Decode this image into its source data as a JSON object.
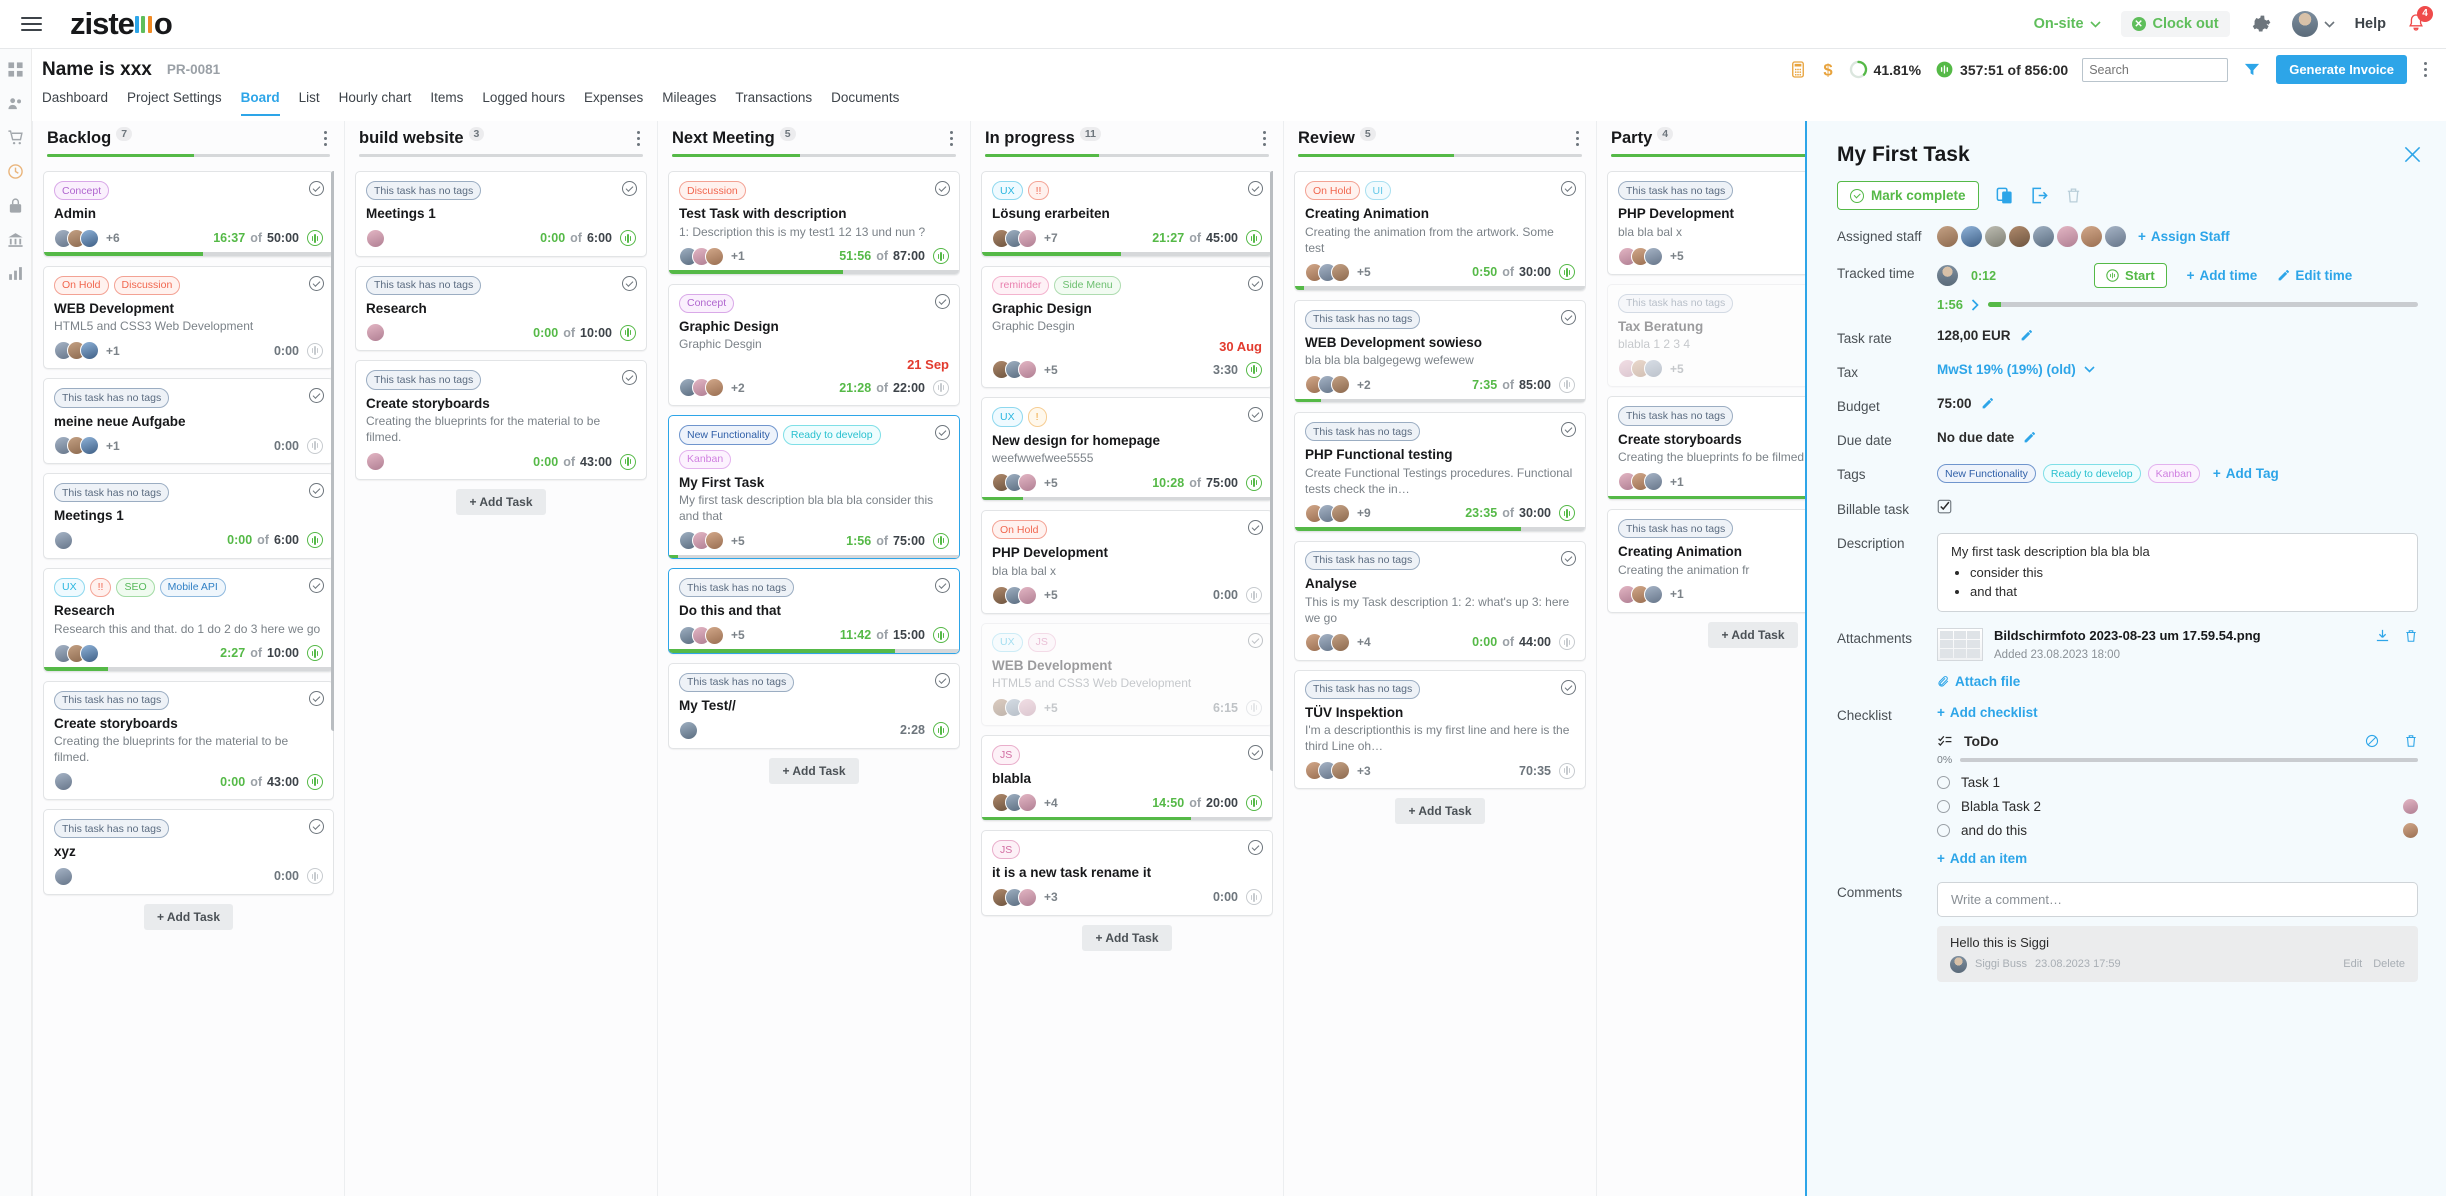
{
  "brand": {
    "name": "zistemo",
    "bar_colors": [
      "#2da5e8",
      "#5fbe5b",
      "#f08a24"
    ]
  },
  "topbar": {
    "onsite_label": "On-site",
    "clockout_label": "Clock out",
    "help_label": "Help",
    "notification_count": "4"
  },
  "project": {
    "name": "Name is xxx",
    "code": "PR-0081",
    "percent": "41.81%",
    "time": "357:51 of 856:00",
    "search_placeholder": "Search",
    "generate_label": "Generate Invoice"
  },
  "tabs": [
    {
      "label": "Dashboard",
      "active": false
    },
    {
      "label": "Project Settings",
      "active": false
    },
    {
      "label": "Board",
      "active": true
    },
    {
      "label": "List",
      "active": false
    },
    {
      "label": "Hourly chart",
      "active": false
    },
    {
      "label": "Items",
      "active": false
    },
    {
      "label": "Logged hours",
      "active": false
    },
    {
      "label": "Expenses",
      "active": false
    },
    {
      "label": "Mileages",
      "active": false
    },
    {
      "label": "Transactions",
      "active": false
    },
    {
      "label": "Documents",
      "active": false
    }
  ],
  "add_task_label": "+ Add Task",
  "columns": [
    {
      "title": "Backlog",
      "count": "7",
      "progress": 52,
      "cards": [
        {
          "tags": [
            {
              "label": "Concept",
              "cls": "t-concept"
            }
          ],
          "title": "Admin",
          "desc": "",
          "avatars": 3,
          "plus": "+6",
          "t1": "16:37",
          "of": "of",
          "t2": "50:00",
          "wave": true,
          "progress": 55
        },
        {
          "tags": [
            {
              "label": "On Hold",
              "cls": "t-onhold"
            },
            {
              "label": "Discussion",
              "cls": "t-disc"
            }
          ],
          "title": "WEB Development",
          "desc": "HTML5 and CSS3 Web Development",
          "avatars": 3,
          "plus": "+1",
          "t1": "",
          "of": "",
          "t2": "0:00",
          "gray": true,
          "wave": false,
          "progress": 0
        },
        {
          "tags": [
            {
              "label": "This task has no tags",
              "cls": "t-notags"
            }
          ],
          "title": "meine neue Aufgabe",
          "desc": "",
          "avatars": 3,
          "plus": "+1",
          "t1": "",
          "of": "",
          "t2": "0:00",
          "gray": true,
          "wave": false,
          "progress": 0
        },
        {
          "tags": [
            {
              "label": "This task has no tags",
              "cls": "t-notags"
            }
          ],
          "title": "Meetings 1",
          "desc": "",
          "avatars": 1,
          "plus": "",
          "t1": "0:00",
          "of": "of",
          "t2": "6:00",
          "wave": true,
          "progress": 0
        },
        {
          "tags": [
            {
              "label": "UX",
              "cls": "t-ux"
            },
            {
              "label": "!!",
              "cls": "t-excl-r"
            },
            {
              "label": "SEO",
              "cls": "t-seo"
            },
            {
              "label": "Mobile API",
              "cls": "t-mobile"
            }
          ],
          "title": "Research",
          "desc": "Research this and that. do 1 do 2 do 3 here we go",
          "avatars": 3,
          "plus": "",
          "t1": "2:27",
          "of": "of",
          "t2": "10:00",
          "wave": true,
          "progress": 22
        },
        {
          "tags": [
            {
              "label": "This task has no tags",
              "cls": "t-notags"
            }
          ],
          "title": "Create storyboards",
          "desc": "Creating the blueprints for the material to be filmed.",
          "avatars": 1,
          "plus": "",
          "t1": "0:00",
          "of": "of",
          "t2": "43:00",
          "wave": true,
          "progress": 0
        },
        {
          "tags": [
            {
              "label": "This task has no tags",
              "cls": "t-notags"
            }
          ],
          "title": "xyz",
          "desc": "",
          "avatars": 1,
          "plus": "",
          "t1": "",
          "of": "",
          "t2": "0:00",
          "gray": true,
          "wave": false,
          "progress": 0
        }
      ]
    },
    {
      "title": "build website",
      "count": "3",
      "progress": 0,
      "cards": [
        {
          "tags": [
            {
              "label": "This task has no tags",
              "cls": "t-notags"
            }
          ],
          "title": "Meetings 1",
          "desc": "",
          "avatars": 1,
          "plus": "",
          "t1": "0:00",
          "of": "of",
          "t2": "6:00",
          "wave": true,
          "progress": 0
        },
        {
          "tags": [
            {
              "label": "This task has no tags",
              "cls": "t-notags"
            }
          ],
          "title": "Research",
          "desc": "",
          "avatars": 1,
          "plus": "",
          "t1": "0:00",
          "of": "of",
          "t2": "10:00",
          "wave": true,
          "progress": 0
        },
        {
          "tags": [
            {
              "label": "This task has no tags",
              "cls": "t-notags"
            }
          ],
          "title": "Create storyboards",
          "desc": "Creating the blueprints for the material to be filmed.",
          "avatars": 1,
          "plus": "",
          "t1": "0:00",
          "of": "of",
          "t2": "43:00",
          "wave": true,
          "progress": 0
        }
      ]
    },
    {
      "title": "Next Meeting",
      "count": "5",
      "progress": 45,
      "cards": [
        {
          "tags": [
            {
              "label": "Discussion",
              "cls": "t-disc"
            }
          ],
          "title": "Test Task with description",
          "desc": "1: Description this is my test1 12 13 und nun ?",
          "avatars": 3,
          "plus": "+1",
          "t1": "51:56",
          "of": "of",
          "t2": "87:00",
          "wave": true,
          "progress": 60
        },
        {
          "tags": [
            {
              "label": "Concept",
              "cls": "t-concept"
            }
          ],
          "title": "Graphic Design",
          "desc": "Graphic Desgin",
          "due": "21 Sep",
          "avatars": 3,
          "plus": "+2",
          "t1": "21:28",
          "of": "of",
          "t2": "22:00",
          "wave": false,
          "progress": 0
        },
        {
          "tags": [
            {
              "label": "New Functionality",
              "cls": "t-new"
            },
            {
              "label": "Ready to develop",
              "cls": "t-ready"
            },
            {
              "label": "Kanban",
              "cls": "t-kanban"
            }
          ],
          "title": "My First Task",
          "desc": "My first task description bla bla bla consider this and that",
          "avatars": 3,
          "plus": "+5",
          "t1": "1:56",
          "of": "of",
          "t2": "75:00",
          "wave": true,
          "selected": true,
          "progress": 3
        },
        {
          "tags": [
            {
              "label": "This task has no tags",
              "cls": "t-notags"
            }
          ],
          "title": "Do this and that",
          "desc": "",
          "avatars": 3,
          "plus": "+5",
          "t1": "11:42",
          "of": "of",
          "t2": "15:00",
          "wave": true,
          "selected": true,
          "progress": 78
        },
        {
          "tags": [
            {
              "label": "This task has no tags",
              "cls": "t-notags"
            }
          ],
          "title": "My Test//",
          "desc": "",
          "avatars": 1,
          "plus": "",
          "t1": "",
          "of": "",
          "t2": "2:28",
          "gray": true,
          "wave": true,
          "progress": 0
        }
      ]
    },
    {
      "title": "In progress",
      "count": "11",
      "progress": 40,
      "cards": [
        {
          "tags": [
            {
              "label": "UX",
              "cls": "t-ux"
            },
            {
              "label": "!!",
              "cls": "t-excl-r"
            }
          ],
          "title": "Lösung erarbeiten",
          "desc": "",
          "avatars": 3,
          "plus": "+7",
          "t1": "21:27",
          "of": "of",
          "t2": "45:00",
          "wave": true,
          "progress": 48
        },
        {
          "tags": [
            {
              "label": "reminder",
              "cls": "t-reminder"
            },
            {
              "label": "Side Menu",
              "cls": "t-side"
            }
          ],
          "title": "Graphic Design",
          "desc": "Graphic Desgin",
          "due": "30 Aug",
          "avatars": 3,
          "plus": "+5",
          "t1": "",
          "of": "",
          "t2": "3:30",
          "gray": true,
          "wave": true,
          "progress": 0
        },
        {
          "tags": [
            {
              "label": "UX",
              "cls": "t-ux"
            },
            {
              "label": "!",
              "cls": "t-excl-o"
            }
          ],
          "title": "New design for homepage",
          "desc": "weefwwefwee5555",
          "avatars": 3,
          "plus": "+5",
          "t1": "10:28",
          "of": "of",
          "t2": "75:00",
          "wave": true,
          "progress": 14
        },
        {
          "tags": [
            {
              "label": "On Hold",
              "cls": "t-onhold"
            }
          ],
          "title": "PHP Development",
          "desc": "bla bla bal x",
          "avatars": 3,
          "plus": "+5",
          "t1": "",
          "of": "",
          "t2": "0:00",
          "gray": true,
          "wave": false,
          "progress": 0
        },
        {
          "tags": [
            {
              "label": "UX",
              "cls": "t-ux"
            },
            {
              "label": "JS",
              "cls": "t-js"
            }
          ],
          "title": "WEB Development",
          "desc": "HTML5 and CSS3 Web Development",
          "avatars": 3,
          "plus": "+5",
          "t1": "",
          "of": "",
          "t2": "6:15",
          "gray": true,
          "wave": false,
          "dim": true,
          "progress": 0
        },
        {
          "tags": [
            {
              "label": "JS",
              "cls": "t-js"
            }
          ],
          "title": "blabla",
          "desc": "",
          "avatars": 3,
          "plus": "+4",
          "t1": "14:50",
          "of": "of",
          "t2": "20:00",
          "wave": true,
          "progress": 72
        },
        {
          "tags": [
            {
              "label": "JS",
              "cls": "t-js"
            }
          ],
          "title": "it is a new task rename it",
          "desc": "",
          "avatars": 3,
          "plus": "+3",
          "t1": "",
          "of": "",
          "t2": "0:00",
          "gray": true,
          "wave": false,
          "progress": 0
        }
      ]
    },
    {
      "title": "Review",
      "count": "5",
      "progress": 55,
      "cards": [
        {
          "tags": [
            {
              "label": "On Hold",
              "cls": "t-onhold"
            },
            {
              "label": "UI",
              "cls": "t-ui"
            }
          ],
          "title": "Creating Animation",
          "desc": "Creating the animation from the artwork. Some test",
          "avatars": 3,
          "plus": "+5",
          "t1": "0:50",
          "of": "of",
          "t2": "30:00",
          "wave": true,
          "progress": 3
        },
        {
          "tags": [
            {
              "label": "This task has no tags",
              "cls": "t-notags"
            }
          ],
          "title": "WEB Development sowieso",
          "desc": "bla bla bla balgegewg wefewew",
          "avatars": 3,
          "plus": "+2",
          "t1": "7:35",
          "of": "of",
          "t2": "85:00",
          "wave": false,
          "progress": 9
        },
        {
          "tags": [
            {
              "label": "This task has no tags",
              "cls": "t-notags"
            }
          ],
          "title": "PHP Functional testing",
          "desc": "Create Functional Testings procedures. Functional tests check the in…",
          "avatars": 3,
          "plus": "+9",
          "t1": "23:35",
          "of": "of",
          "t2": "30:00",
          "wave": true,
          "progress": 78
        },
        {
          "tags": [
            {
              "label": "This task has no tags",
              "cls": "t-notags"
            }
          ],
          "title": "Analyse",
          "desc": "This is my Task description 1: 2: what's up 3: here we go",
          "avatars": 3,
          "plus": "+4",
          "t1": "0:00",
          "of": "of",
          "t2": "44:00",
          "wave": false,
          "progress": 0
        },
        {
          "tags": [
            {
              "label": "This task has no tags",
              "cls": "t-notags"
            }
          ],
          "title": "TÜV Inspektion",
          "desc": "I'm a descriptionthis is my first line and here is the third Line oh…",
          "avatars": 3,
          "plus": "+3",
          "t1": "",
          "of": "",
          "t2": "70:35",
          "gray": true,
          "wave": false,
          "progress": 0
        }
      ]
    },
    {
      "title": "Party",
      "count": "4",
      "progress": 100,
      "cards": [
        {
          "tags": [
            {
              "label": "This task has no tags",
              "cls": "t-notags"
            }
          ],
          "title": "PHP Development",
          "desc": "bla bla bal x",
          "avatars": 3,
          "plus": "+5",
          "t1": "",
          "of": "",
          "t2": "",
          "wave": false,
          "progress": 0
        },
        {
          "tags": [
            {
              "label": "This task has no tags",
              "cls": "t-notags"
            }
          ],
          "title": "Tax Beratung",
          "desc": "blabla 1 2 3 4",
          "avatars": 3,
          "plus": "+5",
          "t1": "",
          "of": "",
          "t2": "",
          "wave": false,
          "dim": true,
          "progress": 0
        },
        {
          "tags": [
            {
              "label": "This task has no tags",
              "cls": "t-notags"
            }
          ],
          "title": "Create storyboards",
          "desc": "Creating the blueprints fo be filmed.",
          "avatars": 3,
          "plus": "+1",
          "t1": "",
          "of": "",
          "t2": "",
          "wave": false,
          "progress": 100
        },
        {
          "tags": [
            {
              "label": "This task has no tags",
              "cls": "t-notags"
            }
          ],
          "title": "Creating Animation",
          "desc": "Creating the animation fr",
          "avatars": 3,
          "plus": "+1",
          "t1": "",
          "of": "",
          "t2": "",
          "wave": false,
          "progress": 0
        }
      ]
    }
  ],
  "panel": {
    "title": "My First Task",
    "mark_complete_label": "Mark complete",
    "assigned_staff_label": "Assigned staff",
    "assign_staff_label": "Assign Staff",
    "assigned_count": 8,
    "tracked_time_label": "Tracked time",
    "tracked_user_time": "0:12",
    "start_label": "Start",
    "add_time_label": "Add time",
    "edit_time_label": "Edit time",
    "tracked_total": "1:56",
    "tracked_progress": 3,
    "task_rate_label": "Task rate",
    "task_rate_value": "128,00 EUR",
    "tax_label": "Tax",
    "tax_value": "MwSt 19% (19%) (old)",
    "budget_label": "Budget",
    "budget_value": "75:00",
    "due_date_label": "Due date",
    "due_date_value": "No due date",
    "tags_label": "Tags",
    "tags": [
      {
        "label": "New Functionality",
        "cls": "t-new"
      },
      {
        "label": "Ready to develop",
        "cls": "t-ready"
      },
      {
        "label": "Kanban",
        "cls": "t-kanban"
      }
    ],
    "add_tag_label": "Add Tag",
    "billable_label": "Billable task",
    "description_label": "Description",
    "description_head": "My first task description bla bla bla",
    "description_items": [
      "consider this",
      "and that"
    ],
    "attachments_label": "Attachments",
    "attachment_name": "Bildschirmfoto 2023-08-23 um 17.59.54.png",
    "attachment_meta": "Added 23.08.2023 18:00",
    "attach_file_label": "Attach file",
    "checklist_label": "Checklist",
    "add_checklist_label": "Add checklist",
    "checklist_title": "ToDo",
    "checklist_percent": "0%",
    "checklist_items": [
      {
        "label": "Task 1",
        "avatar": false
      },
      {
        "label": "Blabla Task 2",
        "avatar": true
      },
      {
        "label": "and do this",
        "avatar": true
      }
    ],
    "add_item_label": "Add an item",
    "comments_label": "Comments",
    "comment_placeholder": "Write a comment…",
    "comment_body": "Hello this is Siggi",
    "comment_author": "Siggi Buss",
    "comment_date": "23.08.2023 17:59",
    "comment_edit": "Edit",
    "comment_delete": "Delete"
  },
  "colors": {
    "accent": "#2da5e8",
    "green": "#55b947",
    "red": "#e23b2e"
  }
}
